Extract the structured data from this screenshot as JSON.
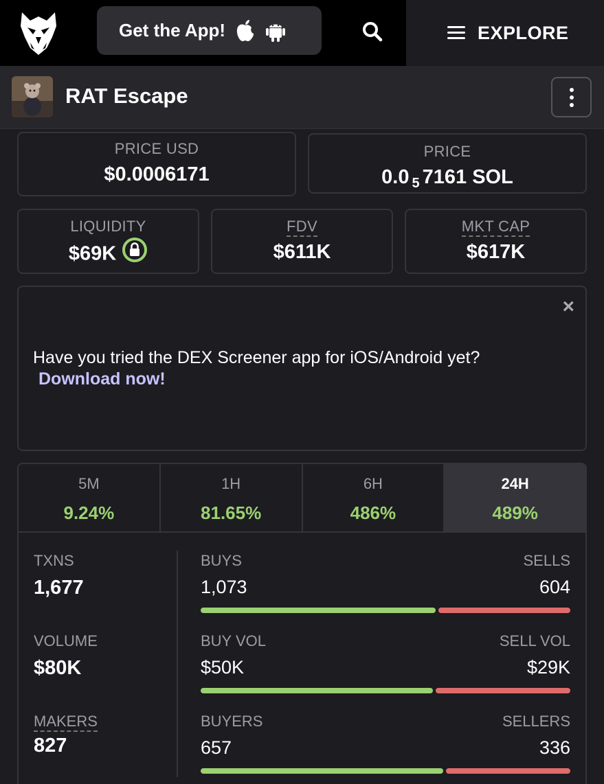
{
  "nav": {
    "get_app_label": "Get the App!",
    "explore_label": "EXPLORE"
  },
  "token": {
    "name": "RAT Escape"
  },
  "price_usd": {
    "label": "PRICE USD",
    "value": "$0.0006171"
  },
  "price_sol": {
    "label": "PRICE",
    "value_prefix": "0.0",
    "value_subscript": "5",
    "value_suffix": "7161 SOL"
  },
  "liquidity": {
    "label": "LIQUIDITY",
    "value": "$69K"
  },
  "fdv": {
    "label": "FDV",
    "value": "$611K"
  },
  "mkt_cap": {
    "label": "MKT CAP",
    "value": "$617K"
  },
  "promo": {
    "message": "Have you tried the DEX Screener app for iOS/Android yet?",
    "link": "Download now!",
    "close": "×"
  },
  "tabs": [
    {
      "label": "5M",
      "value": "9.24%"
    },
    {
      "label": "1H",
      "value": "81.65%"
    },
    {
      "label": "6H",
      "value": "486%"
    },
    {
      "label": "24H",
      "value": "489%"
    }
  ],
  "active_tab": "24H",
  "stats": {
    "txns": {
      "label": "TXNS",
      "value": "1,677"
    },
    "volume": {
      "label": "VOLUME",
      "value": "$80K"
    },
    "makers": {
      "label": "MAKERS",
      "value": "827"
    },
    "buys": {
      "label": "BUYS",
      "value": "1,073",
      "count": 1073
    },
    "sells": {
      "label": "SELLS",
      "value": "604",
      "count": 604
    },
    "buy_vol": {
      "label": "BUY VOL",
      "value": "$50K",
      "amount": 50
    },
    "sell_vol": {
      "label": "SELL VOL",
      "value": "$29K",
      "amount": 29
    },
    "buyers": {
      "label": "BUYERS",
      "value": "657",
      "count": 657
    },
    "sellers": {
      "label": "SELLERS",
      "value": "336",
      "count": 336
    }
  },
  "colors": {
    "positive": "#9bd170",
    "negative": "#e06b6b",
    "link": "#c7c3ff",
    "background": "#1c1c21"
  }
}
